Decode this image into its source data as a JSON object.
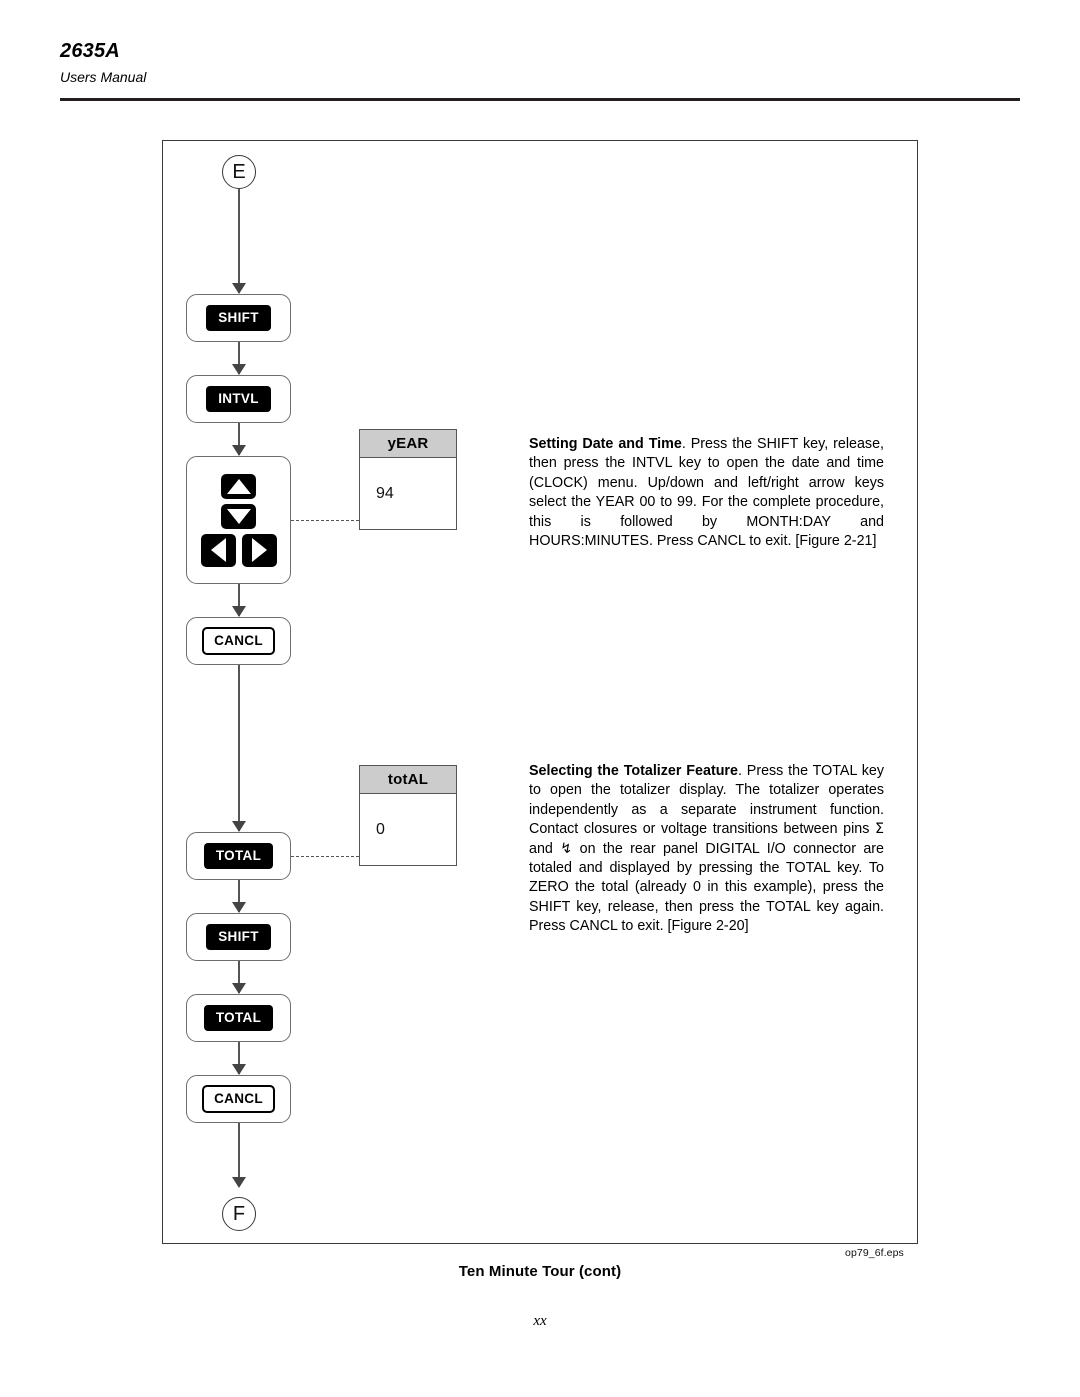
{
  "header": {
    "model": "2635A",
    "subtitle": "Users Manual"
  },
  "figure": {
    "id_label": "op79_6f.eps",
    "caption": "Ten Minute Tour (cont)",
    "entry_connector": "E",
    "exit_connector": "F",
    "steps": [
      {
        "name": "shift-1",
        "label": "SHIFT",
        "style": "filled"
      },
      {
        "name": "intvl",
        "label": "INTVL",
        "style": "filled"
      },
      {
        "name": "arrowpad",
        "label": "",
        "style": "arrowpad"
      },
      {
        "name": "cancl-1",
        "label": "CANCL",
        "style": "outlined"
      },
      {
        "name": "total-1",
        "label": "TOTAL",
        "style": "filled"
      },
      {
        "name": "shift-2",
        "label": "SHIFT",
        "style": "filled"
      },
      {
        "name": "total-2",
        "label": "TOTAL",
        "style": "filled"
      },
      {
        "name": "cancl-2",
        "label": "CANCL",
        "style": "outlined"
      }
    ],
    "displays": [
      {
        "name": "year-display",
        "title": "yEAR",
        "value": "94"
      },
      {
        "name": "total-display",
        "title": "totAL",
        "value": "0"
      }
    ]
  },
  "content": {
    "paragraphs": [
      {
        "name": "setting-date-and-time",
        "heading": "Setting Date and Time",
        "body_before_symbol": ". Press the SHIFT key, release, then press the INTVL key to open the date and time (CLOCK) menu. Up/down and left/right arrow keys select the YEAR 00 to 99. For the complete procedure, this is followed by MONTH:DAY and HOURS:MINUTES. Press CANCL to exit. [Figure 2-21]"
      },
      {
        "name": "selecting-the-totalizer-feature",
        "heading": "Selecting the Totalizer Feature",
        "body_part_1": ". Press the TOTAL key to open the totalizer display. The totalizer operates independently as a separate instrument function. Contact closures or voltage transitions between pins ",
        "symbol_sigma": "Σ",
        "body_part_2": " and ",
        "symbol_ground": "↯",
        "body_part_3": " on the rear panel DIGITAL I/O connector are totaled and displayed by pressing the TOTAL key. To ZERO the total (already 0 in this example), press the SHIFT key, release, then press the TOTAL key again. Press CANCL to exit. [Figure 2-20]"
      }
    ]
  },
  "footer": {
    "page_number": "xx"
  }
}
